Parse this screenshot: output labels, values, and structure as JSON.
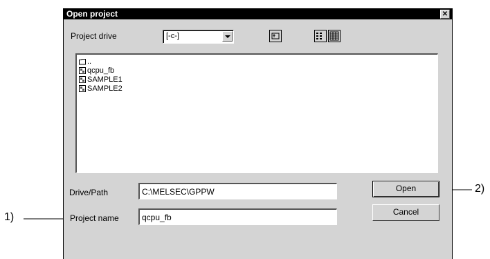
{
  "dialog": {
    "title": "Open project",
    "close_glyph": "✕",
    "project_drive_label": "Project drive",
    "project_drive_value": "[-c-]",
    "files": [
      {
        "name": "..",
        "icon": "folder-icon"
      },
      {
        "name": "qcpu_fb",
        "icon": "project-icon"
      },
      {
        "name": "SAMPLE1",
        "icon": "project-icon"
      },
      {
        "name": "SAMPLE2",
        "icon": "project-icon"
      }
    ],
    "drive_path_label": "Drive/Path",
    "drive_path_value": "C:\\MELSEC\\GPPW",
    "project_name_label": "Project name",
    "project_name_value": "qcpu_fb",
    "open_label": "Open",
    "cancel_label": "Cancel"
  },
  "annotations": {
    "callout_1": "1)",
    "callout_2": "2)"
  }
}
